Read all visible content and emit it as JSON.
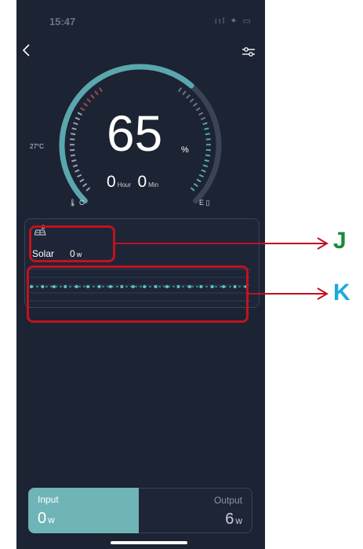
{
  "status_bar": {
    "time": "15:47",
    "icons": "ııl ✦ ▭"
  },
  "gauge": {
    "percent": "65",
    "percent_unit": "%",
    "hours": "0",
    "hours_unit": "Hour",
    "minutes": "0",
    "minutes_unit": "Min",
    "temperature": "27°C",
    "cold_label": "C",
    "empty_label": "E",
    "battery_level": 0.65
  },
  "solar": {
    "label": "Solar",
    "value": "0",
    "unit": "w",
    "points": [
      0,
      0,
      0,
      0,
      0,
      0,
      0,
      0,
      0,
      0,
      0,
      0,
      0,
      0,
      0,
      0,
      0,
      0,
      0,
      0
    ]
  },
  "annotations": {
    "j": "J",
    "k": "K"
  },
  "tabs": {
    "input": {
      "label": "Input",
      "value": "0",
      "unit": "w"
    },
    "output": {
      "label": "Output",
      "value": "6",
      "unit": "w"
    }
  },
  "colors": {
    "background": "#1c2333",
    "accent": "#6fb4b7",
    "annotation_box": "#c1121f",
    "label_j": "#1a8a3a",
    "label_k": "#1aa9e0"
  }
}
